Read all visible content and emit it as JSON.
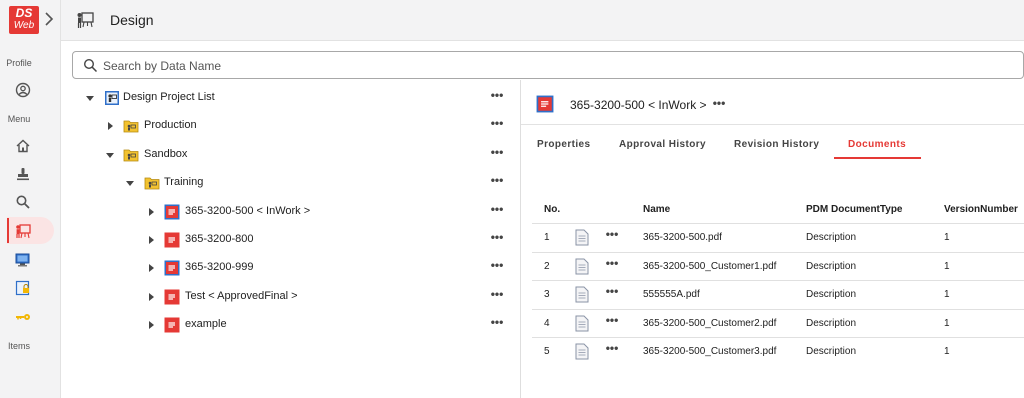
{
  "app": {
    "logo_line1": "DS",
    "logo_line2": "Web"
  },
  "rail": {
    "profile_label": "Profile",
    "menu_label": "Menu",
    "items_label": "Items",
    "icons": [
      "profile-icon",
      "home-icon",
      "stamp-icon",
      "search-icon",
      "design-icon",
      "monitor-icon",
      "lock-doc-icon",
      "key-icon"
    ],
    "active": "design-icon"
  },
  "header": {
    "title": "Design"
  },
  "search": {
    "placeholder": "Search by Data Name",
    "value": ""
  },
  "tree": {
    "nodes": [
      {
        "label": "Design Project List",
        "level": 0,
        "expanded": true,
        "icon": "project-list-icon",
        "more": "•••"
      },
      {
        "label": "Production",
        "level": 1,
        "expanded": false,
        "icon": "folder-icon",
        "more": "•••"
      },
      {
        "label": "Sandbox",
        "level": 1,
        "expanded": true,
        "icon": "folder-icon",
        "more": "•••"
      },
      {
        "label": "Training",
        "level": 2,
        "expanded": true,
        "icon": "folder-icon",
        "more": "•••"
      },
      {
        "label": "365-3200-500 < InWork >",
        "level": 3,
        "expanded": false,
        "icon": "design-item-blue-icon",
        "more": "•••"
      },
      {
        "label": "365-3200-800",
        "level": 3,
        "expanded": false,
        "icon": "design-item-red-icon",
        "more": "•••"
      },
      {
        "label": "365-3200-999",
        "level": 3,
        "expanded": false,
        "icon": "design-item-blue-icon",
        "more": "•••"
      },
      {
        "label": "Test < ApprovedFinal >",
        "level": 3,
        "expanded": false,
        "icon": "design-item-red-icon",
        "more": "•••"
      },
      {
        "label": "example",
        "level": 3,
        "expanded": false,
        "icon": "design-item-red-icon",
        "more": "•••"
      }
    ]
  },
  "detail": {
    "title": "365-3200-500 < InWork >",
    "more": "•••",
    "tabs": [
      {
        "label": "Properties",
        "active": false
      },
      {
        "label": "Approval History",
        "active": false
      },
      {
        "label": "Revision History",
        "active": false
      },
      {
        "label": "Documents",
        "active": true
      }
    ],
    "table": {
      "columns": [
        "No.",
        "Name",
        "PDM DocumentType",
        "VersionNumber"
      ],
      "rows": [
        {
          "no": "1",
          "more": "•••",
          "name": "365-3200-500.pdf",
          "type": "Description",
          "version": "1"
        },
        {
          "no": "2",
          "more": "•••",
          "name": "365-3200-500_Customer1.pdf",
          "type": "Description",
          "version": "1"
        },
        {
          "no": "3",
          "more": "•••",
          "name": "555555A.pdf",
          "type": "Description",
          "version": "1"
        },
        {
          "no": "4",
          "more": "•••",
          "name": "365-3200-500_Customer2.pdf",
          "type": "Description",
          "version": "1"
        },
        {
          "no": "5",
          "more": "•••",
          "name": "365-3200-500_Customer3.pdf",
          "type": "Description",
          "version": "1"
        }
      ]
    }
  },
  "colors": {
    "accent": "#e53935",
    "rail_bg": "#f3f3f4",
    "folder": "#f2c230"
  }
}
